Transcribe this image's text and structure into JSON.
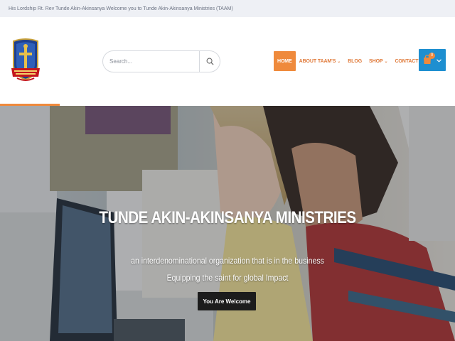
{
  "topbar": {
    "welcome_text": "His Lordship Rt. Rev Tunde Akin-Akinsanya Welcome you to Tunde Akin-Akinsanya Ministries (TAAM)"
  },
  "header": {
    "logo_icon": "shield-cross-crest-icon",
    "search": {
      "placeholder": "Search...",
      "icon": "search-icon"
    },
    "nav": {
      "home": "HOME",
      "about": "ABOUT TAAM'S",
      "blog": "BLOG",
      "shop": "SHOP",
      "contact": "CONTACT US",
      "caret": "⌄"
    },
    "cart": {
      "count": "0",
      "icon": "shopping-bag-icon",
      "chevron_icon": "chevron-down-icon"
    }
  },
  "hero": {
    "title": "TUNDE AKIN-AKINSANYA MINISTRIES",
    "line1": "an interdenominational organization that is in the business",
    "line2": "Equipping the saint for global Impact",
    "button_label": "You Are Welcome"
  },
  "colors": {
    "accent_orange": "#ef8a3c",
    "nav_text": "#e07a3a",
    "cart_blue": "#1e8fd0",
    "topbar_bg": "#eef0f5",
    "button_dark": "#1c1c1c"
  }
}
